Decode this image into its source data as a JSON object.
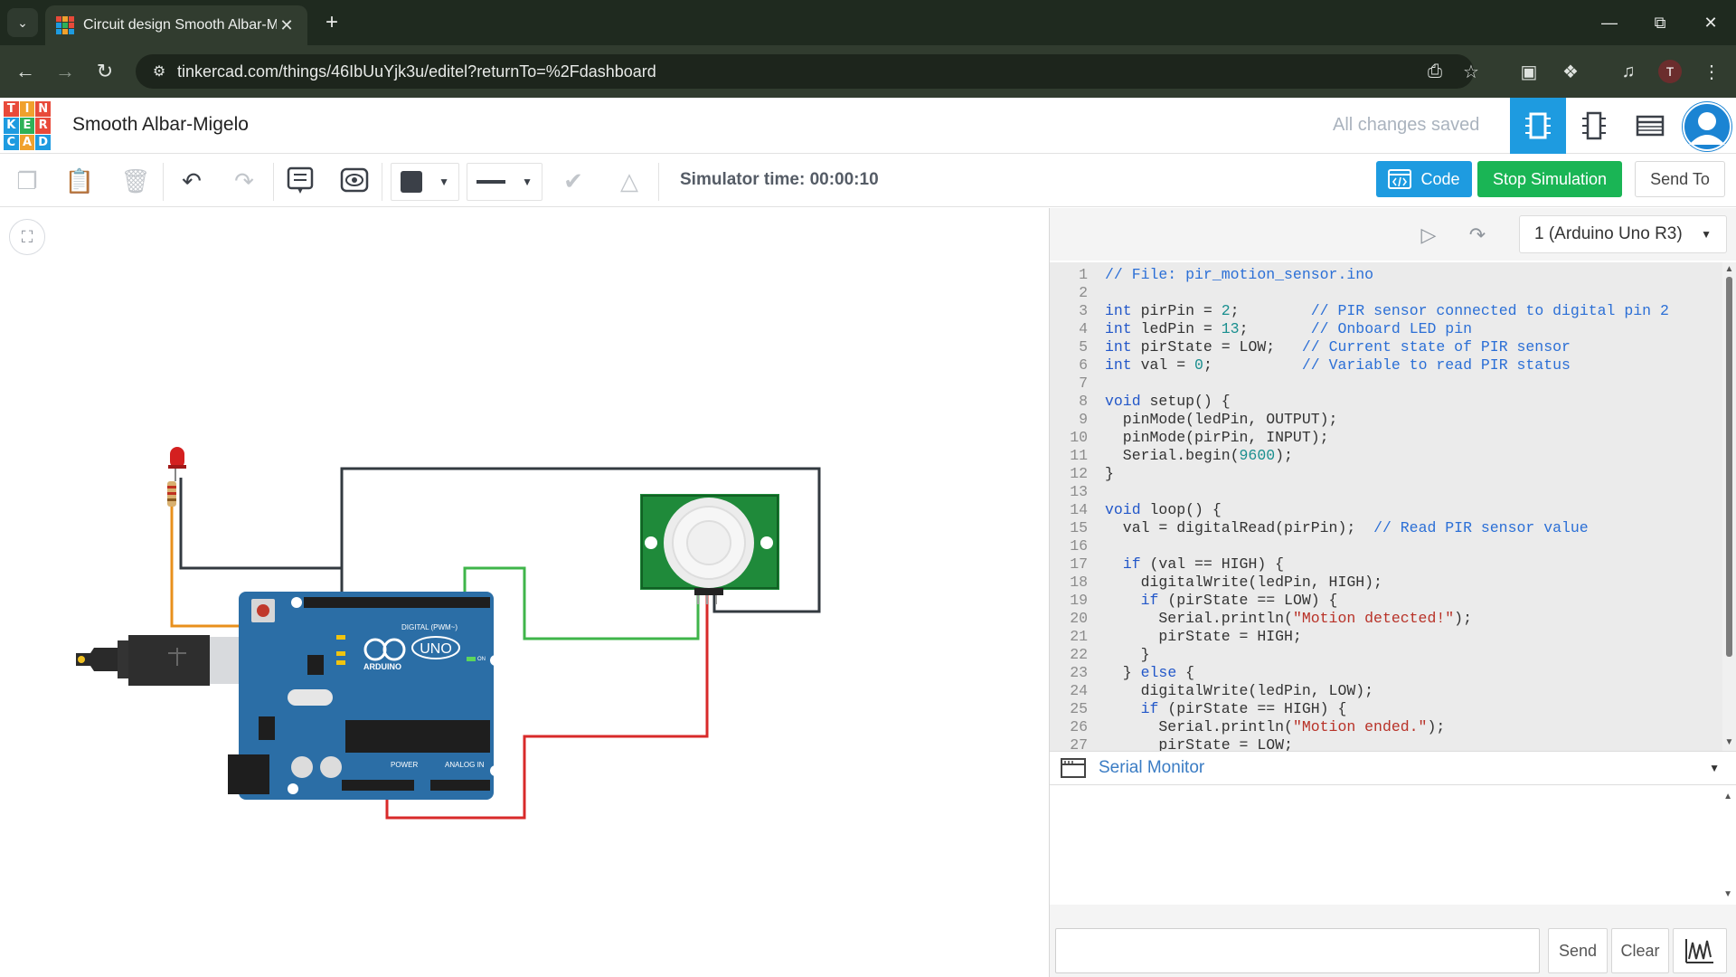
{
  "browser": {
    "tab_title": "Circuit design Smooth Albar-Mi",
    "url": "tinkercad.com/things/46IbUuYjk3u/editel?returnTo=%2Fdashboard",
    "profile_initial": "T"
  },
  "app": {
    "logo_letters": [
      "T",
      "I",
      "N",
      "K",
      "E",
      "R",
      "C",
      "A",
      "D"
    ],
    "logo_colors": [
      "#e84a3a",
      "#f0a12d",
      "#e84a3a",
      "#1e9be0",
      "#2fb157",
      "#e84a3a",
      "#1e9be0",
      "#f0a12d",
      "#1e9be0"
    ],
    "project_title": "Smooth Albar-Migelo",
    "save_status": "All changes saved",
    "accent_color": "#1e9be0"
  },
  "toolbar": {
    "simulator_time": "Simulator time: 00:00:10",
    "code_label": "Code",
    "stop_label": "Stop Simulation",
    "send_to_label": "Send To"
  },
  "code_panel": {
    "device": "1 (Arduino Uno R3)",
    "lines": [
      "// File: pir_motion_sensor.ino",
      "",
      "int pirPin = 2;        // PIR sensor connected to digital pin 2",
      "int ledPin = 13;       // Onboard LED pin",
      "int pirState = LOW;   // Current state of PIR sensor",
      "int val = 0;          // Variable to read PIR status",
      "",
      "void setup() {",
      "  pinMode(ledPin, OUTPUT);",
      "  pinMode(pirPin, INPUT);",
      "  Serial.begin(9600);",
      "}",
      "",
      "void loop() {",
      "  val = digitalRead(pirPin);  // Read PIR sensor value",
      "",
      "  if (val == HIGH) {",
      "    digitalWrite(ledPin, HIGH);",
      "    if (pirState == LOW) {",
      "      Serial.println(\"Motion detected!\");",
      "      pirState = HIGH;",
      "    }",
      "  } else {",
      "    digitalWrite(ledPin, LOW);",
      "    if (pirState == HIGH) {",
      "      Serial.println(\"Motion ended.\");",
      "      pirState = LOW;"
    ]
  },
  "serial": {
    "title": "Serial Monitor",
    "input_value": "",
    "send_label": "Send",
    "clear_label": "Clear"
  },
  "board": {
    "brand": "ARDUINO",
    "model": "UNO",
    "digital_label": "DIGITAL (PWM~)",
    "power_label": "POWER",
    "analog_label": "ANALOG IN",
    "on_label": "ON"
  }
}
